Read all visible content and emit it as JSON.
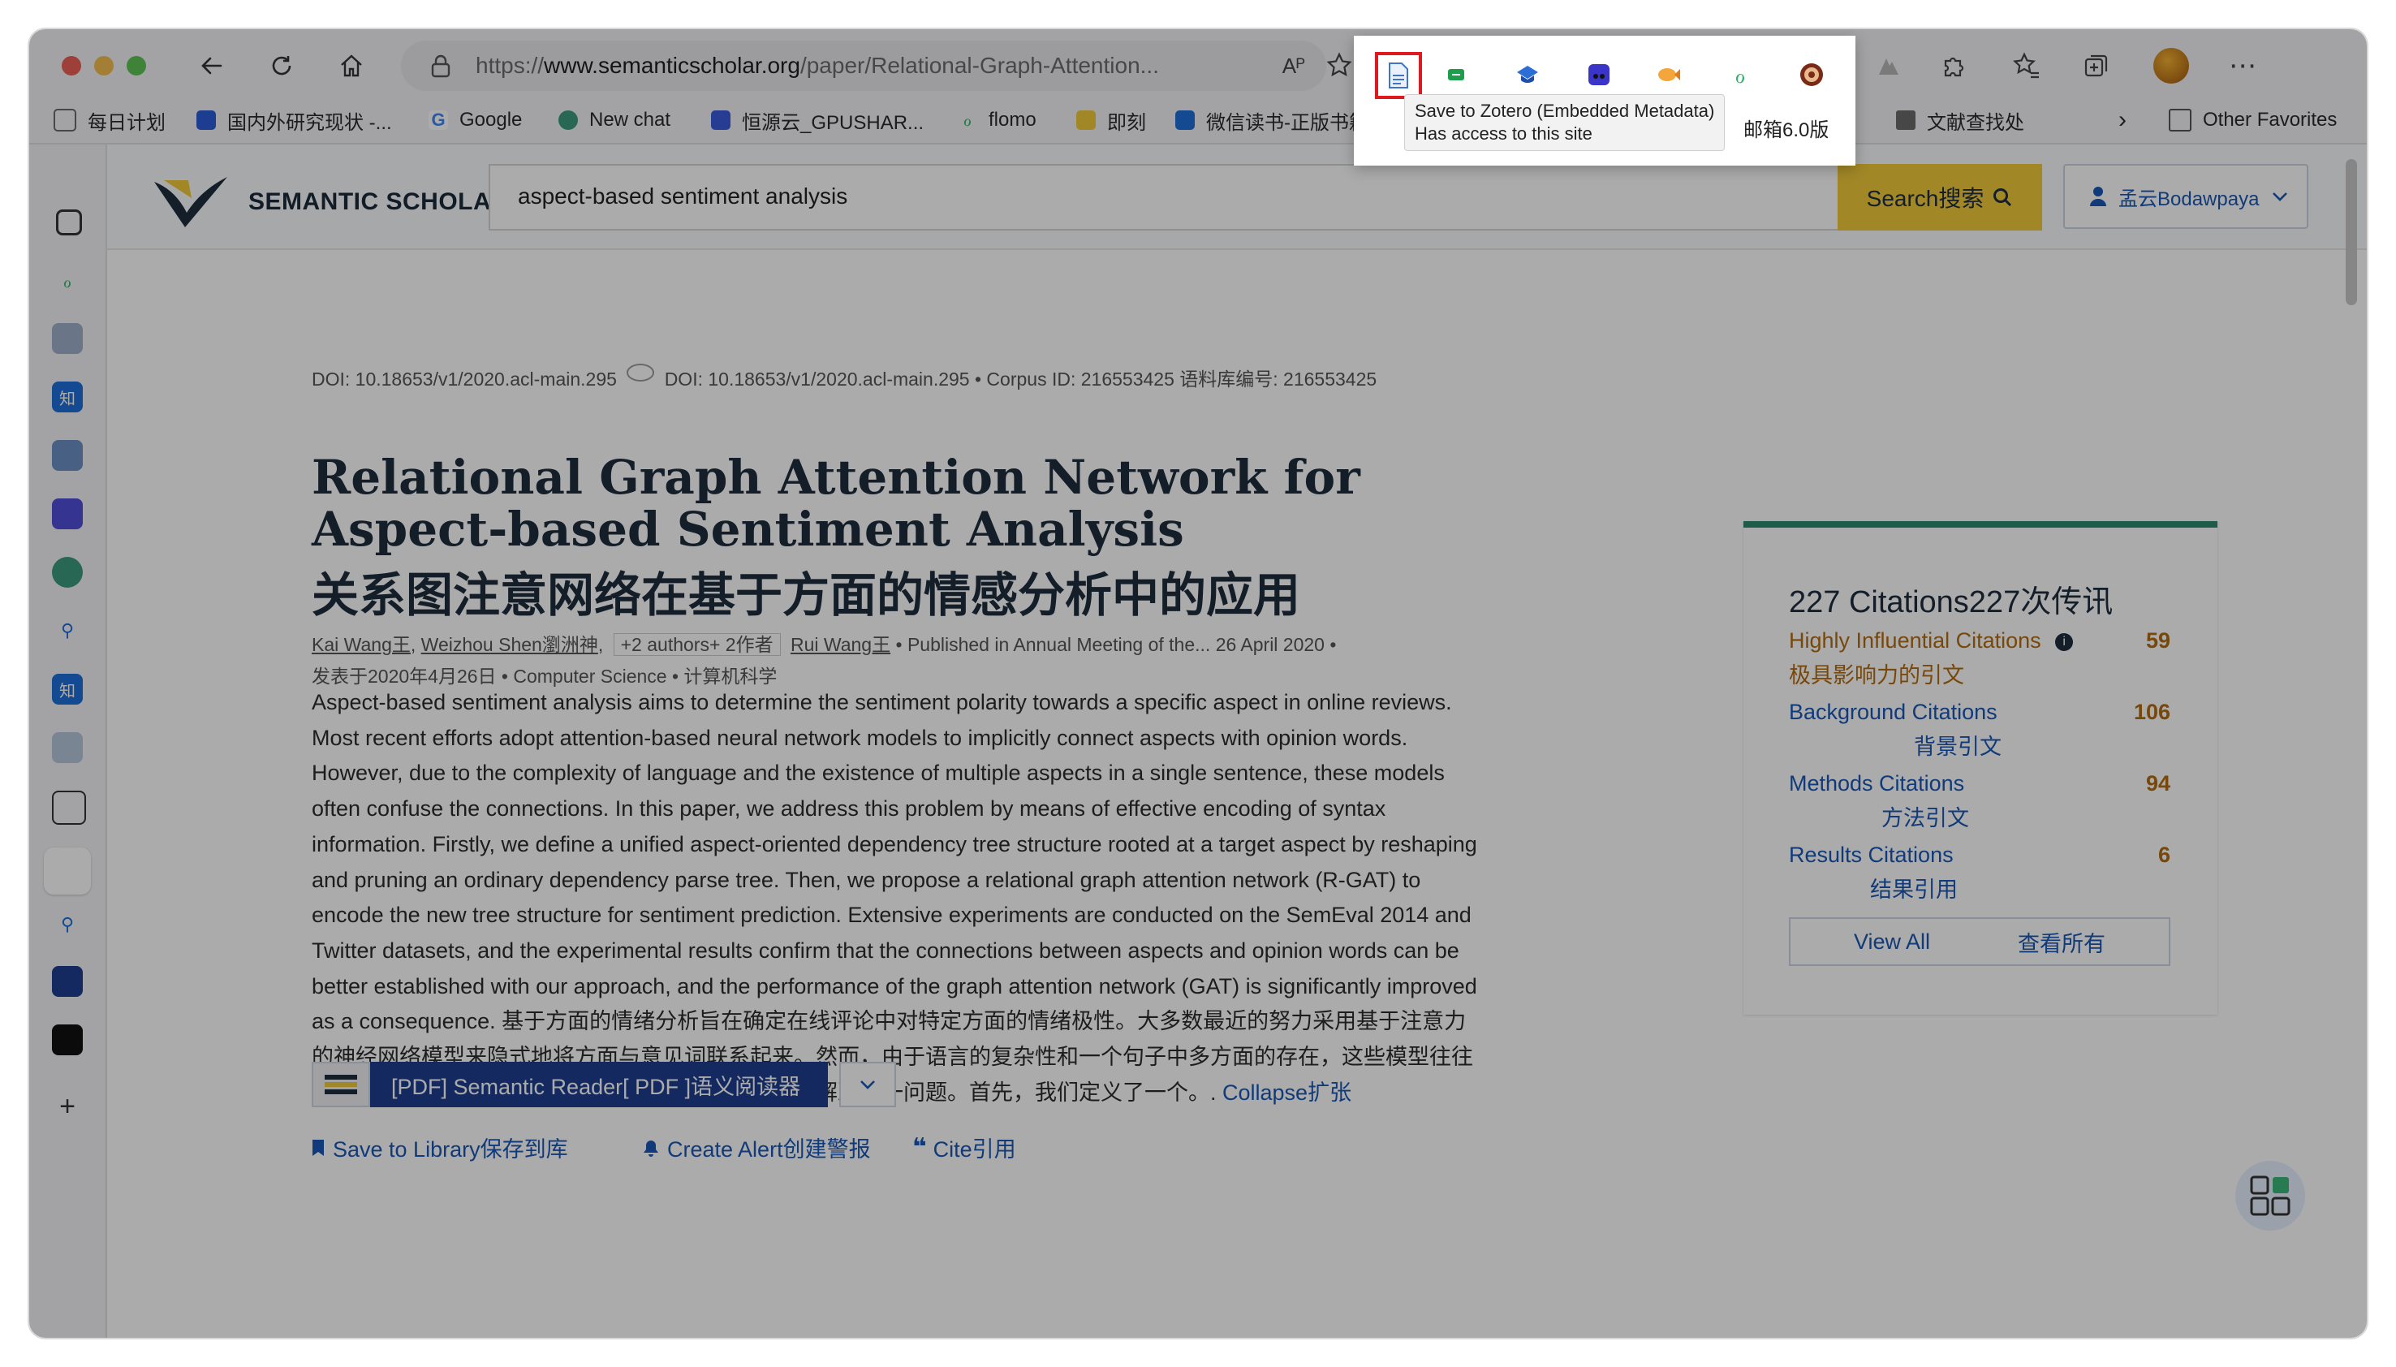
{
  "browser": {
    "url_prefix": "https://",
    "url_domain": "www.semanticscholar.org",
    "url_path": "/paper/Relational-Graph-Attention...",
    "read_aloud_label": "Aᴾ"
  },
  "bookmarks": [
    {
      "label": "每日计划",
      "color": "#6b6b6b"
    },
    {
      "label": "国内外研究现状 -...",
      "color": "#2a5bd7"
    },
    {
      "label": "Google",
      "color": "#4285f4"
    },
    {
      "label": "New chat",
      "color": "#3c9a7d"
    },
    {
      "label": "恒源云_GPUSHAR...",
      "color": "#3b5bdb"
    },
    {
      "label": "flomo",
      "color": "#30b36b"
    },
    {
      "label": "即刻",
      "color": "#f0c93a"
    },
    {
      "label": "微信读书-正版书籍...",
      "color": "#1e6fd9"
    }
  ],
  "bookmarks_right": {
    "mail": "邮箱6.0版",
    "lit": "文献查找处",
    "more": "›",
    "other": "Other Favorites"
  },
  "extension_tooltip": {
    "line1": "Save to Zotero (Embedded Metadata)",
    "line2": "Has access to this site"
  },
  "site": {
    "logo_text": "SEMANTIC SCHOLAR",
    "search_query": "aspect-based sentiment analysis",
    "search_button": "Search搜索",
    "user": "孟云Bodawpaya"
  },
  "paper": {
    "doi_line": "DOI: 10.18653/v1/2020.acl-main.295",
    "doi_line2": "DOI: 10.18653/v1/2020.acl-main.295  •  Corpus ID: 216553425  语料库编号: 216553425",
    "title": "Relational Graph Attention Network for Aspect-based Sentiment Analysis",
    "title_zh": "关系图注意网络在基于方面的情感分析中的应用",
    "author1": "Kai Wang王",
    "author2": "Weizhou Shen瀏洲神",
    "more_authors": "+2 authors+ 2作者",
    "author3": "Rui Wang王",
    "published": "•  Published in Annual Meeting of the...   26 April 2020  •",
    "published_zh": "发表于2020年4月26日  •  Computer Science  •  计算机科学",
    "abstract": "Aspect-based sentiment analysis aims to determine the sentiment polarity towards a specific aspect in online reviews. Most recent efforts adopt attention-based neural network models to implicitly connect aspects with opinion words. However, due to the complexity of language and the existence of multiple aspects in a single sentence, these models often confuse the connections. In this paper, we address this problem by means of effective encoding of syntax information. Firstly, we define a unified aspect-oriented dependency tree structure rooted at a target aspect by reshaping and pruning an ordinary dependency parse tree. Then, we propose a relational graph attention network (R-GAT) to encode the new tree structure for sentiment prediction. Extensive experiments are conducted on the SemEval 2014 and Twitter datasets, and the experimental results confirm that the connections between aspects and opinion words can be better established with our approach, and the performance of the graph attention network (GAT) is significantly improved as a consequence. 基于方面的情绪分析旨在确定在线评论中对特定方面的情绪极性。大多数最近的努力采用基于注意力的神经网络模型来隐式地将方面与意见词联系起来。然而，由于语言的复杂性和一个句子中多方面的存在，这些模型往往混淆了连接。本文通过对句法信息进行有效的编码来解决这一问题。首先，我们定义了一个。.",
    "collapse": "Collapse扩张",
    "reader_button": "[PDF] Semantic Reader[ PDF ]语义阅读器",
    "save_library": "Save to Library保存到库",
    "create_alert": "Create Alert创建警报",
    "cite": "Cite引用"
  },
  "citations": {
    "heading": "227 Citations227次传讯",
    "rows": [
      {
        "label": "Highly Influential Citations",
        "zh": "极具影响力的引文",
        "count": "59",
        "accent": "#b36a10"
      },
      {
        "label": "Background Citations",
        "zh": "背景引文",
        "count": "106",
        "accent": "#1857b6"
      },
      {
        "label": "Methods Citations",
        "zh": "方法引文",
        "count": "94",
        "accent": "#1857b6"
      },
      {
        "label": "Results Citations",
        "zh": "结果引用",
        "count": "6",
        "accent": "#1857b6"
      }
    ],
    "view_all": "View All",
    "view_all_zh": "查看所有"
  }
}
